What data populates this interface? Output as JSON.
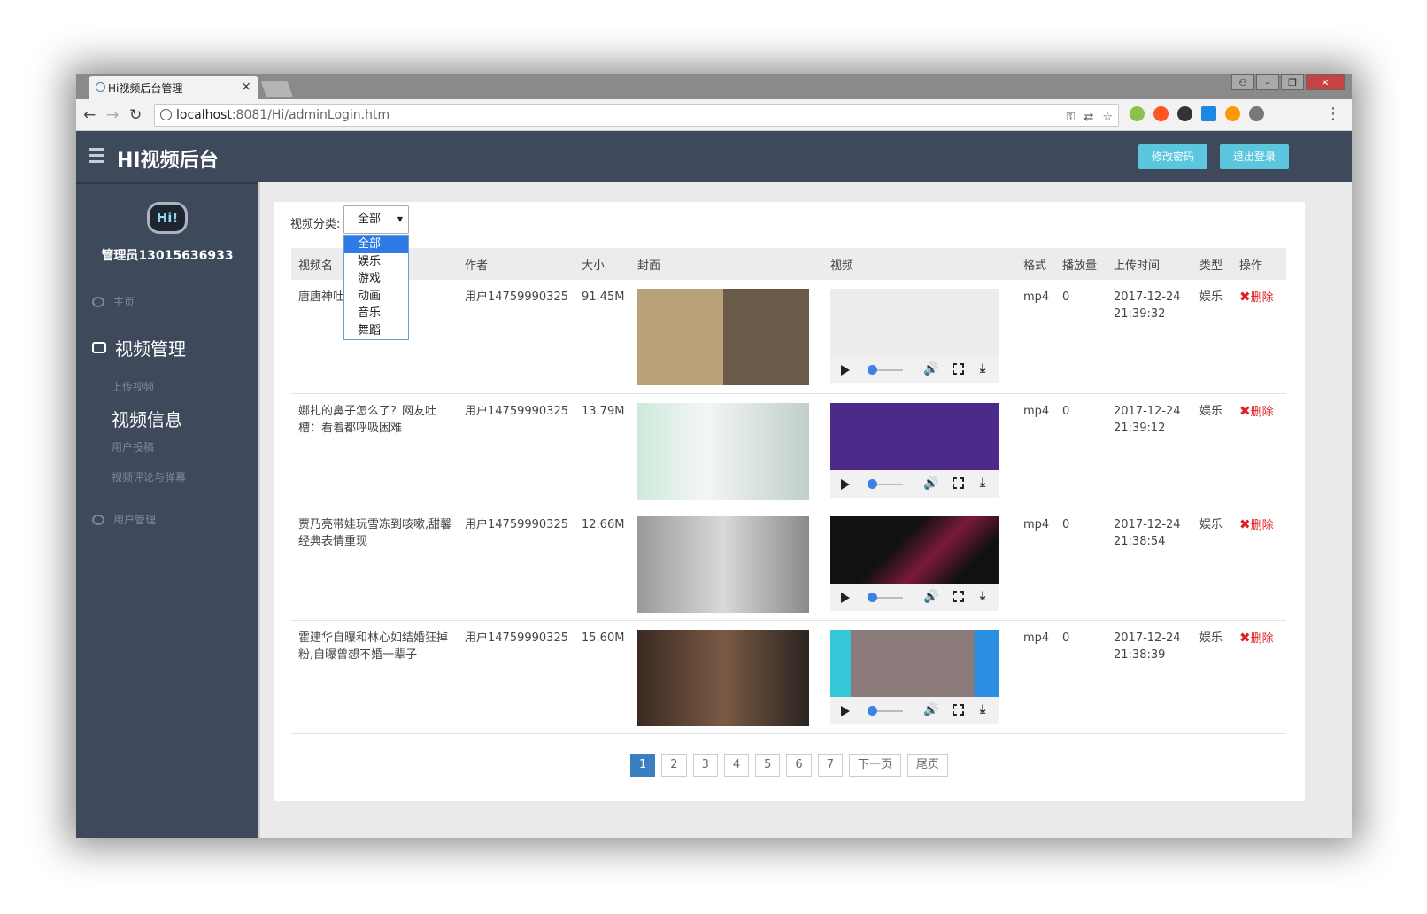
{
  "browser": {
    "tab_title": "Hi视频后台管理",
    "url_host": "localhost",
    "url_rest": ":8081/Hi/adminLogin.htm"
  },
  "header": {
    "title": "HI视频后台",
    "change_password": "修改密码",
    "logout": "退出登录"
  },
  "sidebar": {
    "logo_text": "Hi!",
    "admin": "管理员13015636933",
    "home": "主页",
    "video_mgmt": "视频管理",
    "upload": "上传视频",
    "video_info": "视频信息",
    "user_submit": "用户投稿",
    "comments": "视频评论与弹幕",
    "user_mgmt": "用户管理"
  },
  "filter": {
    "label": "视频分类:",
    "selected": "全部",
    "options": [
      "全部",
      "娱乐",
      "游戏",
      "动画",
      "音乐",
      "舞蹈"
    ]
  },
  "table": {
    "headers": [
      "视频名",
      "作者",
      "大小",
      "封面",
      "视频",
      "格式",
      "播放量",
      "上传时间",
      "类型",
      "操作"
    ],
    "rows": [
      {
        "name": "唐唐神吐槽的结局",
        "author": "用户14759990325",
        "size": "91.45M",
        "format": "mp4",
        "plays": "0",
        "time": "2017-12-24 21:39:32",
        "type": "娱乐",
        "action": "删除"
      },
      {
        "name": "娜扎的鼻子怎么了？网友吐槽：看着都呼吸困难",
        "author": "用户14759990325",
        "size": "13.79M",
        "format": "mp4",
        "plays": "0",
        "time": "2017-12-24 21:39:12",
        "type": "娱乐",
        "action": "删除"
      },
      {
        "name": "贾乃亮带娃玩雪冻到咳嗽,甜馨经典表情重现",
        "author": "用户14759990325",
        "size": "12.66M",
        "format": "mp4",
        "plays": "0",
        "time": "2017-12-24 21:38:54",
        "type": "娱乐",
        "action": "删除"
      },
      {
        "name": "霍建华自曝和林心如结婚狂掉粉,自曝曾想不婚一辈子",
        "author": "用户14759990325",
        "size": "15.60M",
        "format": "mp4",
        "plays": "0",
        "time": "2017-12-24 21:38:39",
        "type": "娱乐",
        "action": "删除"
      }
    ]
  },
  "pagination": {
    "pages": [
      "1",
      "2",
      "3",
      "4",
      "5",
      "6",
      "7"
    ],
    "next": "下一页",
    "last": "尾页"
  }
}
